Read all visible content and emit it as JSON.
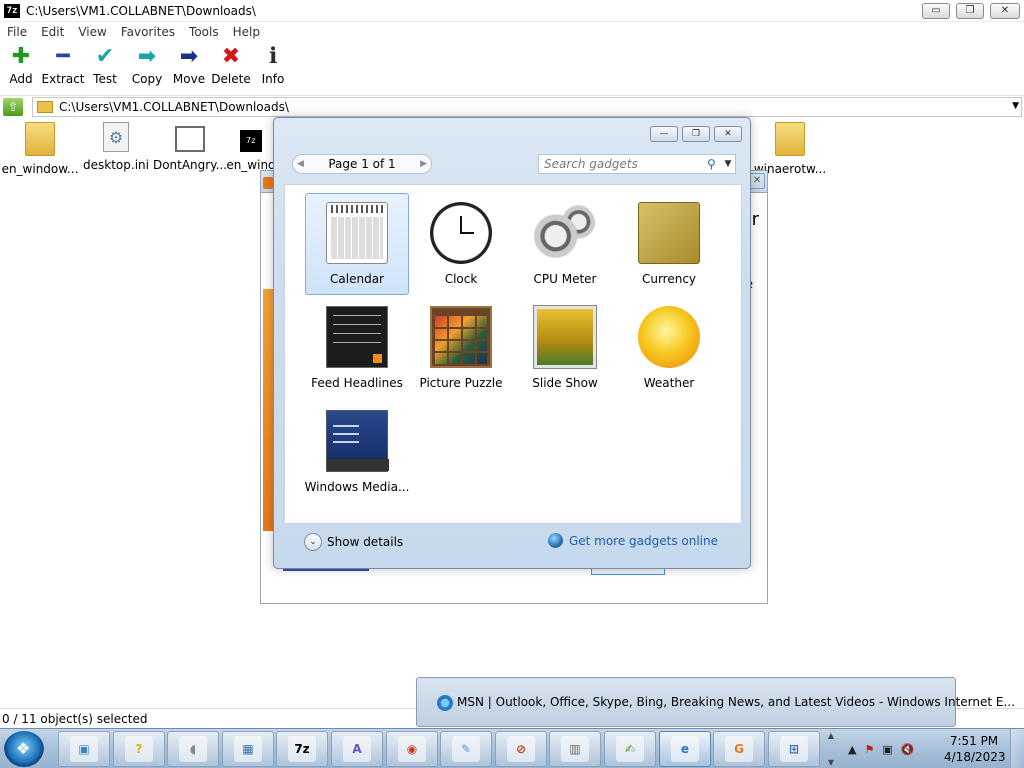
{
  "window": {
    "icon_text": "7z",
    "title": "C:\\Users\\VM1.COLLABNET\\Downloads\\",
    "controls": {
      "minimize": "▭",
      "restore": "❐",
      "close": "✕"
    }
  },
  "menu": [
    "File",
    "Edit",
    "View",
    "Favorites",
    "Tools",
    "Help"
  ],
  "toolbar": [
    {
      "label": "Add",
      "glyph": "✚",
      "color": "#1f9a1f"
    },
    {
      "label": "Extract",
      "glyph": "━",
      "color": "#2a3fb6"
    },
    {
      "label": "Test",
      "glyph": "✔",
      "color": "#19a3a3"
    },
    {
      "label": "Copy",
      "glyph": "➡",
      "color": "#19a3a3"
    },
    {
      "label": "Move",
      "glyph": "➡",
      "color": "#1d2f8a"
    },
    {
      "label": "Delete",
      "glyph": "✖",
      "color": "#d01818"
    },
    {
      "label": "Info",
      "glyph": "ℹ",
      "color": "#2b2b2b"
    }
  ],
  "address": {
    "path": "C:\\Users\\VM1.COLLABNET\\Downloads\\",
    "up_glyph": "⇧",
    "dropdown_glyph": "▼"
  },
  "files": [
    {
      "name": "en_window...",
      "type": "folder"
    },
    {
      "name": "desktop.ini",
      "type": "gear"
    },
    {
      "name": "DontAngry...",
      "type": "doc"
    },
    {
      "name": "en_wind",
      "type": "archive"
    },
    {
      "name": "winaerotw...",
      "type": "folder"
    }
  ],
  "archive_icon_text": "7z",
  "gear_glyph": "⚙",
  "status": "0 / 11 object(s) selected",
  "background_window": {
    "close": "✕",
    "big_char": "r",
    "small_char": "e"
  },
  "gadget_gallery": {
    "controls": {
      "minimize": "—",
      "restore": "❐",
      "close": "✕"
    },
    "pager": {
      "prev": "◀",
      "text": "Page 1 of 1",
      "next": "▶"
    },
    "search": {
      "placeholder": "Search gadgets",
      "icon": "⚲",
      "dropdown": "▼"
    },
    "gadgets": [
      {
        "name": "Calendar",
        "icon": "calendar-icon",
        "selected": true
      },
      {
        "name": "Clock",
        "icon": "clock-icon"
      },
      {
        "name": "CPU Meter",
        "icon": "cpu-meter-icon"
      },
      {
        "name": "Currency",
        "icon": "currency-icon"
      },
      {
        "name": "Feed Headlines",
        "icon": "feed-headlines-icon"
      },
      {
        "name": "Picture Puzzle",
        "icon": "picture-puzzle-icon"
      },
      {
        "name": "Slide Show",
        "icon": "slide-show-icon"
      },
      {
        "name": "Weather",
        "icon": "weather-icon"
      },
      {
        "name": "Windows Media...",
        "icon": "windows-media-center-icon"
      }
    ],
    "show_details": {
      "label": "Show details",
      "chevron": "⌄"
    },
    "get_more": "Get more gadgets online"
  },
  "taskbar_preview": {
    "title": "MSN | Outlook, Office, Skype, Bing, Breaking News, and Latest Videos - Windows Internet E..."
  },
  "taskbar": {
    "apps": [
      {
        "name": "explorer",
        "icon": "photo-viewer-icon",
        "glyph": "▣",
        "color": "#3a7fc0"
      },
      {
        "name": "help",
        "icon": "help-icon",
        "glyph": "?",
        "color": "#e0b020"
      },
      {
        "name": "mouse",
        "icon": "mouse-icon",
        "glyph": "◖",
        "color": "#888888"
      },
      {
        "name": "display",
        "icon": "monitor-icon",
        "glyph": "▦",
        "color": "#3a6fb0"
      },
      {
        "name": "7zip",
        "icon": "7zip-icon",
        "glyph": "7z",
        "color": "#000000"
      },
      {
        "name": "fonts",
        "icon": "font-icon",
        "glyph": "A",
        "color": "#5a5ab8"
      },
      {
        "name": "chrome",
        "icon": "chrome-icon",
        "glyph": "◉",
        "color": "#d33a2c"
      },
      {
        "name": "notepad",
        "icon": "notepad-icon",
        "glyph": "✎",
        "color": "#5aa0d0"
      },
      {
        "name": "blocked",
        "icon": "blocked-app-icon",
        "glyph": "⊘",
        "color": "#c0401a"
      },
      {
        "name": "server",
        "icon": "server-icon",
        "glyph": "▥",
        "color": "#6a6a6a"
      },
      {
        "name": "notepadpp",
        "icon": "notepad-plus-icon",
        "glyph": "✍",
        "color": "#4a9a3a"
      },
      {
        "name": "ie",
        "icon": "internet-explorer-icon",
        "glyph": "e",
        "color": "#2a79c4",
        "active": true
      },
      {
        "name": "installer",
        "icon": "installer-icon",
        "glyph": "G",
        "color": "#e8781a"
      },
      {
        "name": "network",
        "icon": "network-computer-icon",
        "glyph": "⊞",
        "color": "#3a6fb0"
      }
    ],
    "scroll_up": "▲",
    "scroll_down": "▼",
    "tray": {
      "arrow": "▲",
      "flag": "⚑",
      "network": "▣",
      "volume": "🔇"
    },
    "time": "7:51 PM",
    "date": "4/18/2023"
  }
}
